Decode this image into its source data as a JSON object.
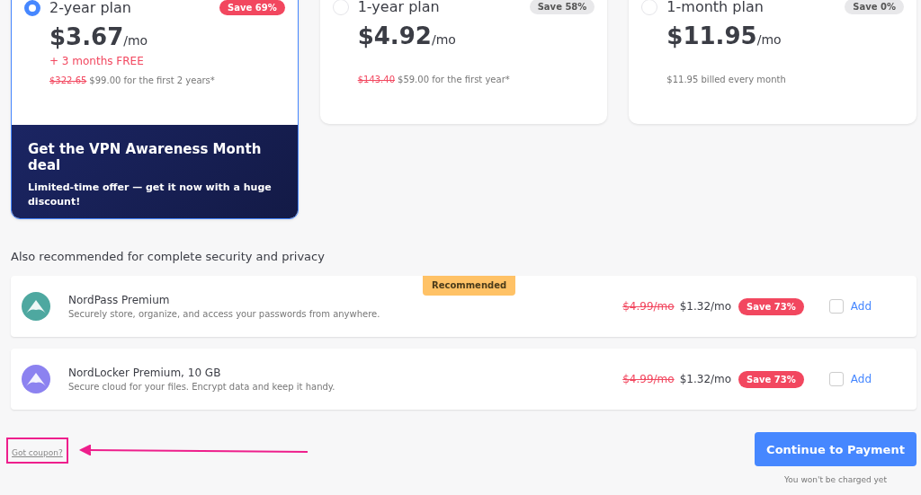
{
  "plans": [
    {
      "name": "2-year plan",
      "selected": true,
      "save": "Save 69%",
      "price": "$3.67",
      "unit": "/mo",
      "bonus": "+ 3 months FREE",
      "old_price": "$322.65",
      "note": "$99.00 for the first 2 years*",
      "promo": {
        "title": "Get the VPN Awareness Month deal",
        "text": "Limited-time offer — get it now with a huge discount!"
      }
    },
    {
      "name": "1-year plan",
      "selected": false,
      "save": "Save 58%",
      "price": "$4.92",
      "unit": "/mo",
      "old_price": "$143.40",
      "note": "$59.00 for the first year*"
    },
    {
      "name": "1-month plan",
      "selected": false,
      "save": "Save 0%",
      "price": "$11.95",
      "unit": "/mo",
      "note": "$11.95 billed every month"
    }
  ],
  "addons_heading": "Also recommended for complete security and privacy",
  "addons": [
    {
      "name": "NordPass Premium",
      "desc": "Securely store, organize, and access your passwords from anywhere.",
      "badge": "Recommended",
      "color": "#4ea8a0",
      "old_price": "$4.99/mo",
      "price": "$1.32/mo",
      "save": "Save 73%",
      "checked": false,
      "action": "Add"
    },
    {
      "name": "NordLocker Premium, 10 GB",
      "desc": "Secure cloud for your files. Encrypt data and keep it handy.",
      "color": "#8c82f0",
      "old_price": "$4.99/mo",
      "price": "$1.32/mo",
      "save": "Save 73%",
      "checked": false,
      "action": "Add"
    }
  ],
  "coupon_link": "Got coupon?",
  "continue_button": "Continue to Payment",
  "charge_note": "You won't be charged yet"
}
